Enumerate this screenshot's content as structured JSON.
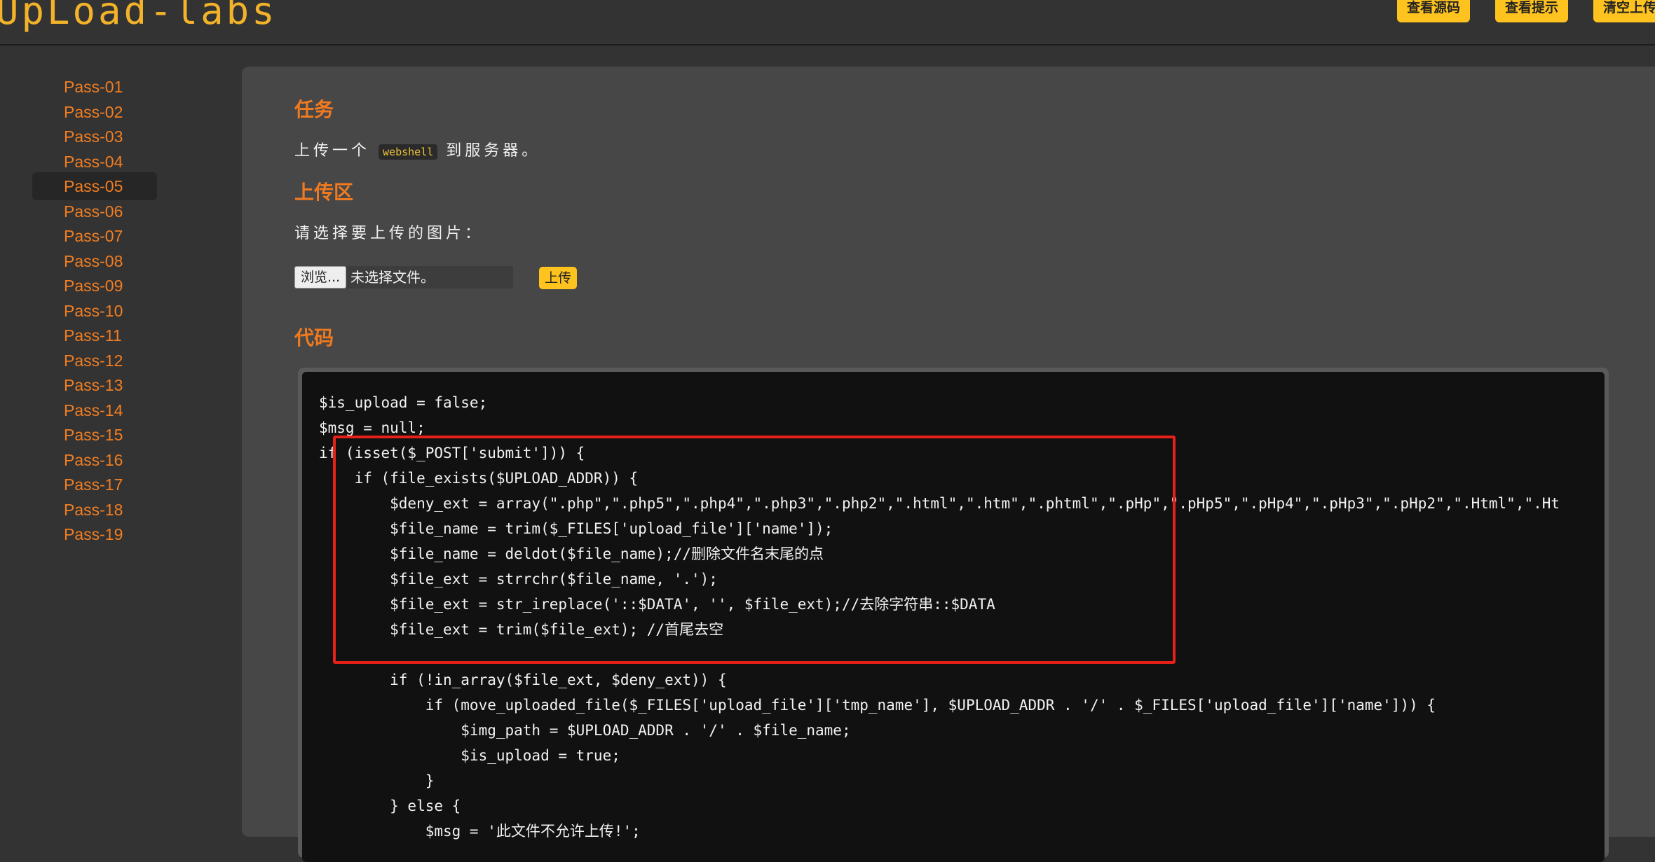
{
  "app": {
    "logo": "UpLoad-labs"
  },
  "header": {
    "buttons": [
      {
        "label": "查看源码"
      },
      {
        "label": "查看提示"
      },
      {
        "label": "清空上传"
      }
    ]
  },
  "sidebar": {
    "items": [
      "Pass-01",
      "Pass-02",
      "Pass-03",
      "Pass-04",
      "Pass-05",
      "Pass-06",
      "Pass-07",
      "Pass-08",
      "Pass-09",
      "Pass-10",
      "Pass-11",
      "Pass-12",
      "Pass-13",
      "Pass-14",
      "Pass-15",
      "Pass-16",
      "Pass-17",
      "Pass-18",
      "Pass-19"
    ],
    "active": "Pass-05"
  },
  "task": {
    "title": "任务",
    "text_before": "上传一个",
    "keyword": "webshell",
    "text_after": "到服务器。"
  },
  "upload": {
    "title": "上传区",
    "prompt": "请选择要上传的图片：",
    "browse_label": "浏览...",
    "file_status": "未选择文件。",
    "submit_label": "上传"
  },
  "code": {
    "title": "代码",
    "lines": [
      "$is_upload = false;",
      "$msg = null;",
      "if (isset($_POST['submit'])) {",
      "    if (file_exists($UPLOAD_ADDR)) {",
      "        $deny_ext = array(\".php\",\".php5\",\".php4\",\".php3\",\".php2\",\".html\",\".htm\",\".phtml\",\".pHp\",\".pHp5\",\".pHp4\",\".pHp3\",\".pHp2\",\".Html\",\".Ht",
      "        $file_name = trim($_FILES['upload_file']['name']);",
      "        $file_name = deldot($file_name);//删除文件名末尾的点",
      "        $file_ext = strrchr($file_name, '.');",
      "        $file_ext = str_ireplace('::$DATA', '', $file_ext);//去除字符串::$DATA",
      "        $file_ext = trim($file_ext); //首尾去空",
      "",
      "        if (!in_array($file_ext, $deny_ext)) {",
      "            if (move_uploaded_file($_FILES['upload_file']['tmp_name'], $UPLOAD_ADDR . '/' . $_FILES['upload_file']['name'])) {",
      "                $img_path = $UPLOAD_ADDR . '/' . $file_name;",
      "                $is_upload = true;",
      "            }",
      "        } else {",
      "            $msg = '此文件不允许上传!';"
    ]
  },
  "colors": {
    "accent": "#ffc31f",
    "nav_link": "#f27e22",
    "section_title": "#f07a20",
    "highlight": "#e8201a"
  }
}
